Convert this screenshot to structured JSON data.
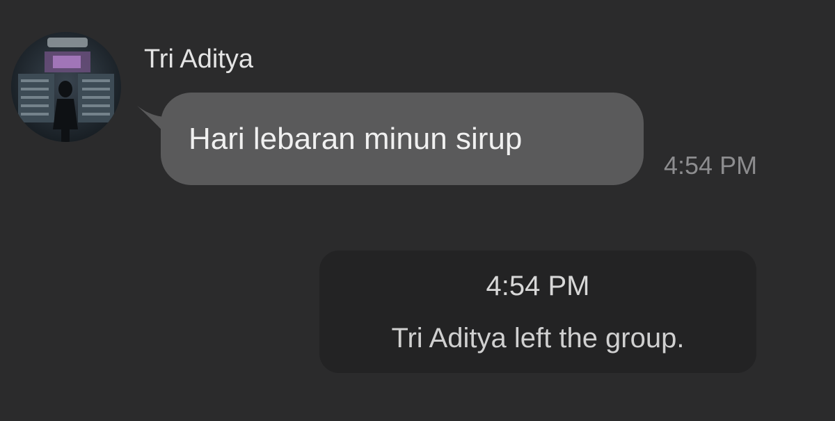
{
  "messages": [
    {
      "sender": "Tri Aditya",
      "avatar_icon": "user-avatar-photo",
      "text": "Hari lebaran minun sirup",
      "time": "4:54 PM"
    }
  ],
  "system_notice": {
    "time": "4:54 PM",
    "text": "Tri Aditya left the group."
  },
  "colors": {
    "background": "#2b2b2c",
    "bubble": "#5a5a5b",
    "system_notice": "#232324",
    "time_text": "#8d8d8f"
  }
}
